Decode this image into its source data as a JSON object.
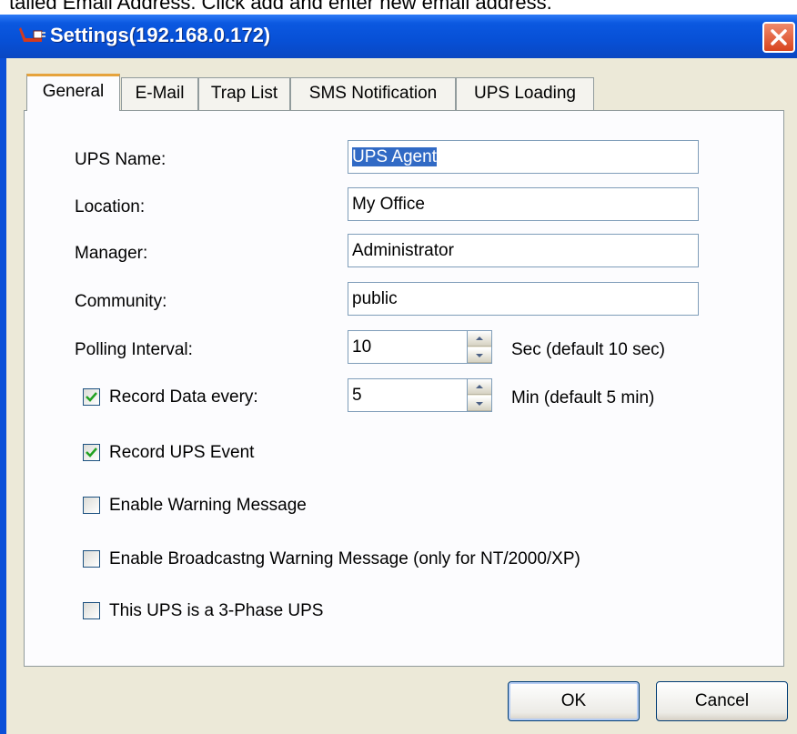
{
  "caption": "tailed Email Address. Click add and enter new email address.",
  "window": {
    "title": "Settings(192.168.0.172)",
    "icons": {
      "app": "ups-plug-icon",
      "close": "close-icon"
    }
  },
  "tabs": [
    {
      "label": "General",
      "active": true
    },
    {
      "label": "E-Mail",
      "active": false
    },
    {
      "label": "Trap List",
      "active": false
    },
    {
      "label": "SMS Notification",
      "active": false
    },
    {
      "label": "UPS Loading",
      "active": false
    }
  ],
  "general": {
    "ups_name": {
      "label": "UPS Name:",
      "value": "UPS Agent"
    },
    "location": {
      "label": "Location:",
      "value": "My Office"
    },
    "manager": {
      "label": "Manager:",
      "value": "Administrator"
    },
    "community": {
      "label": "Community:",
      "value": "public"
    },
    "polling": {
      "label": "Polling Interval:",
      "value": "10",
      "hint": "Sec (default 10 sec)"
    },
    "record_data": {
      "label": "Record Data every:",
      "checked": true,
      "value": "5",
      "hint": "Min (default 5 min)"
    },
    "record_event": {
      "label": "Record UPS Event",
      "checked": true
    },
    "warning_message": {
      "label": "Enable Warning Message",
      "checked": false
    },
    "broadcast_warning": {
      "label": "Enable Broadcastng Warning Message (only for NT/2000/XP)",
      "checked": false
    },
    "three_phase": {
      "label": "This UPS is a 3-Phase UPS",
      "checked": false
    }
  },
  "buttons": {
    "ok": "OK",
    "cancel": "Cancel"
  },
  "colors": {
    "titlebar": "#0750d6",
    "dialog": "#ece9d8",
    "selection": "#316ac5",
    "active_tab": "#e6a33c"
  }
}
